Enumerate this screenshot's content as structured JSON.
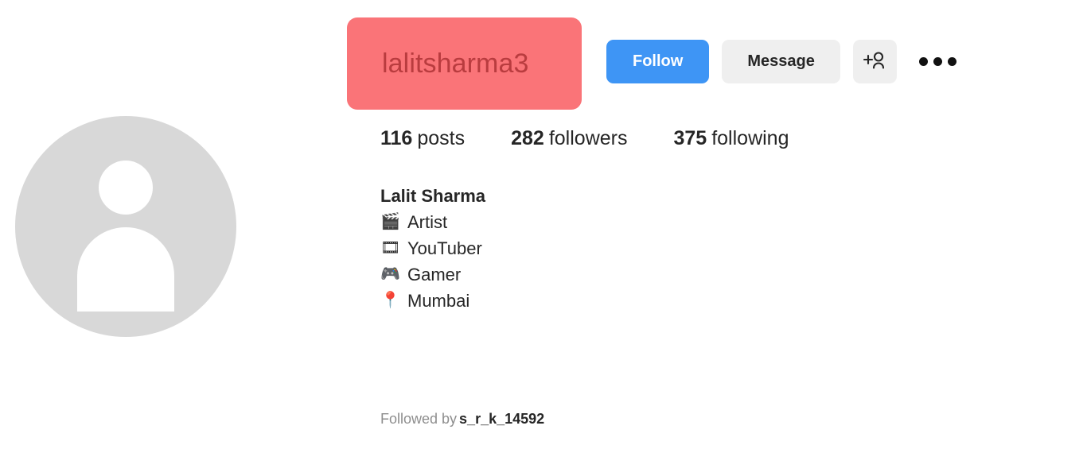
{
  "profile": {
    "username": "lalitsharma3",
    "username_highlight_color": "#fa7478",
    "avatar_icon": "default-person-avatar",
    "stats": [
      {
        "value": "116",
        "label": "posts",
        "name": "posts"
      },
      {
        "value": "282",
        "label": "followers",
        "name": "followers"
      },
      {
        "value": "375",
        "label": "following",
        "name": "following"
      }
    ],
    "bio": {
      "full_name": "Lalit Sharma",
      "lines": [
        {
          "emoji": "🎬",
          "emoji_name": "clapper-board-icon",
          "text": "Artist"
        },
        {
          "emoji": "🎞",
          "emoji_name": "film-frames-icon",
          "text": "YouTuber"
        },
        {
          "emoji": "🎮",
          "emoji_name": "video-game-controller-icon",
          "text": "Gamer"
        },
        {
          "emoji": "📍",
          "emoji_name": "round-pushpin-icon",
          "text": "Mumbai"
        }
      ]
    },
    "followed_by": {
      "prefix": "Followed by",
      "mutual": "s_r_k_14592"
    }
  },
  "actions": {
    "follow_label": "Follow",
    "follow_color": "#3e95f5",
    "message_label": "Message",
    "message_color": "#efefef",
    "add_person_icon": "person-add-icon",
    "more_options_icon": "ellipsis-icon"
  }
}
